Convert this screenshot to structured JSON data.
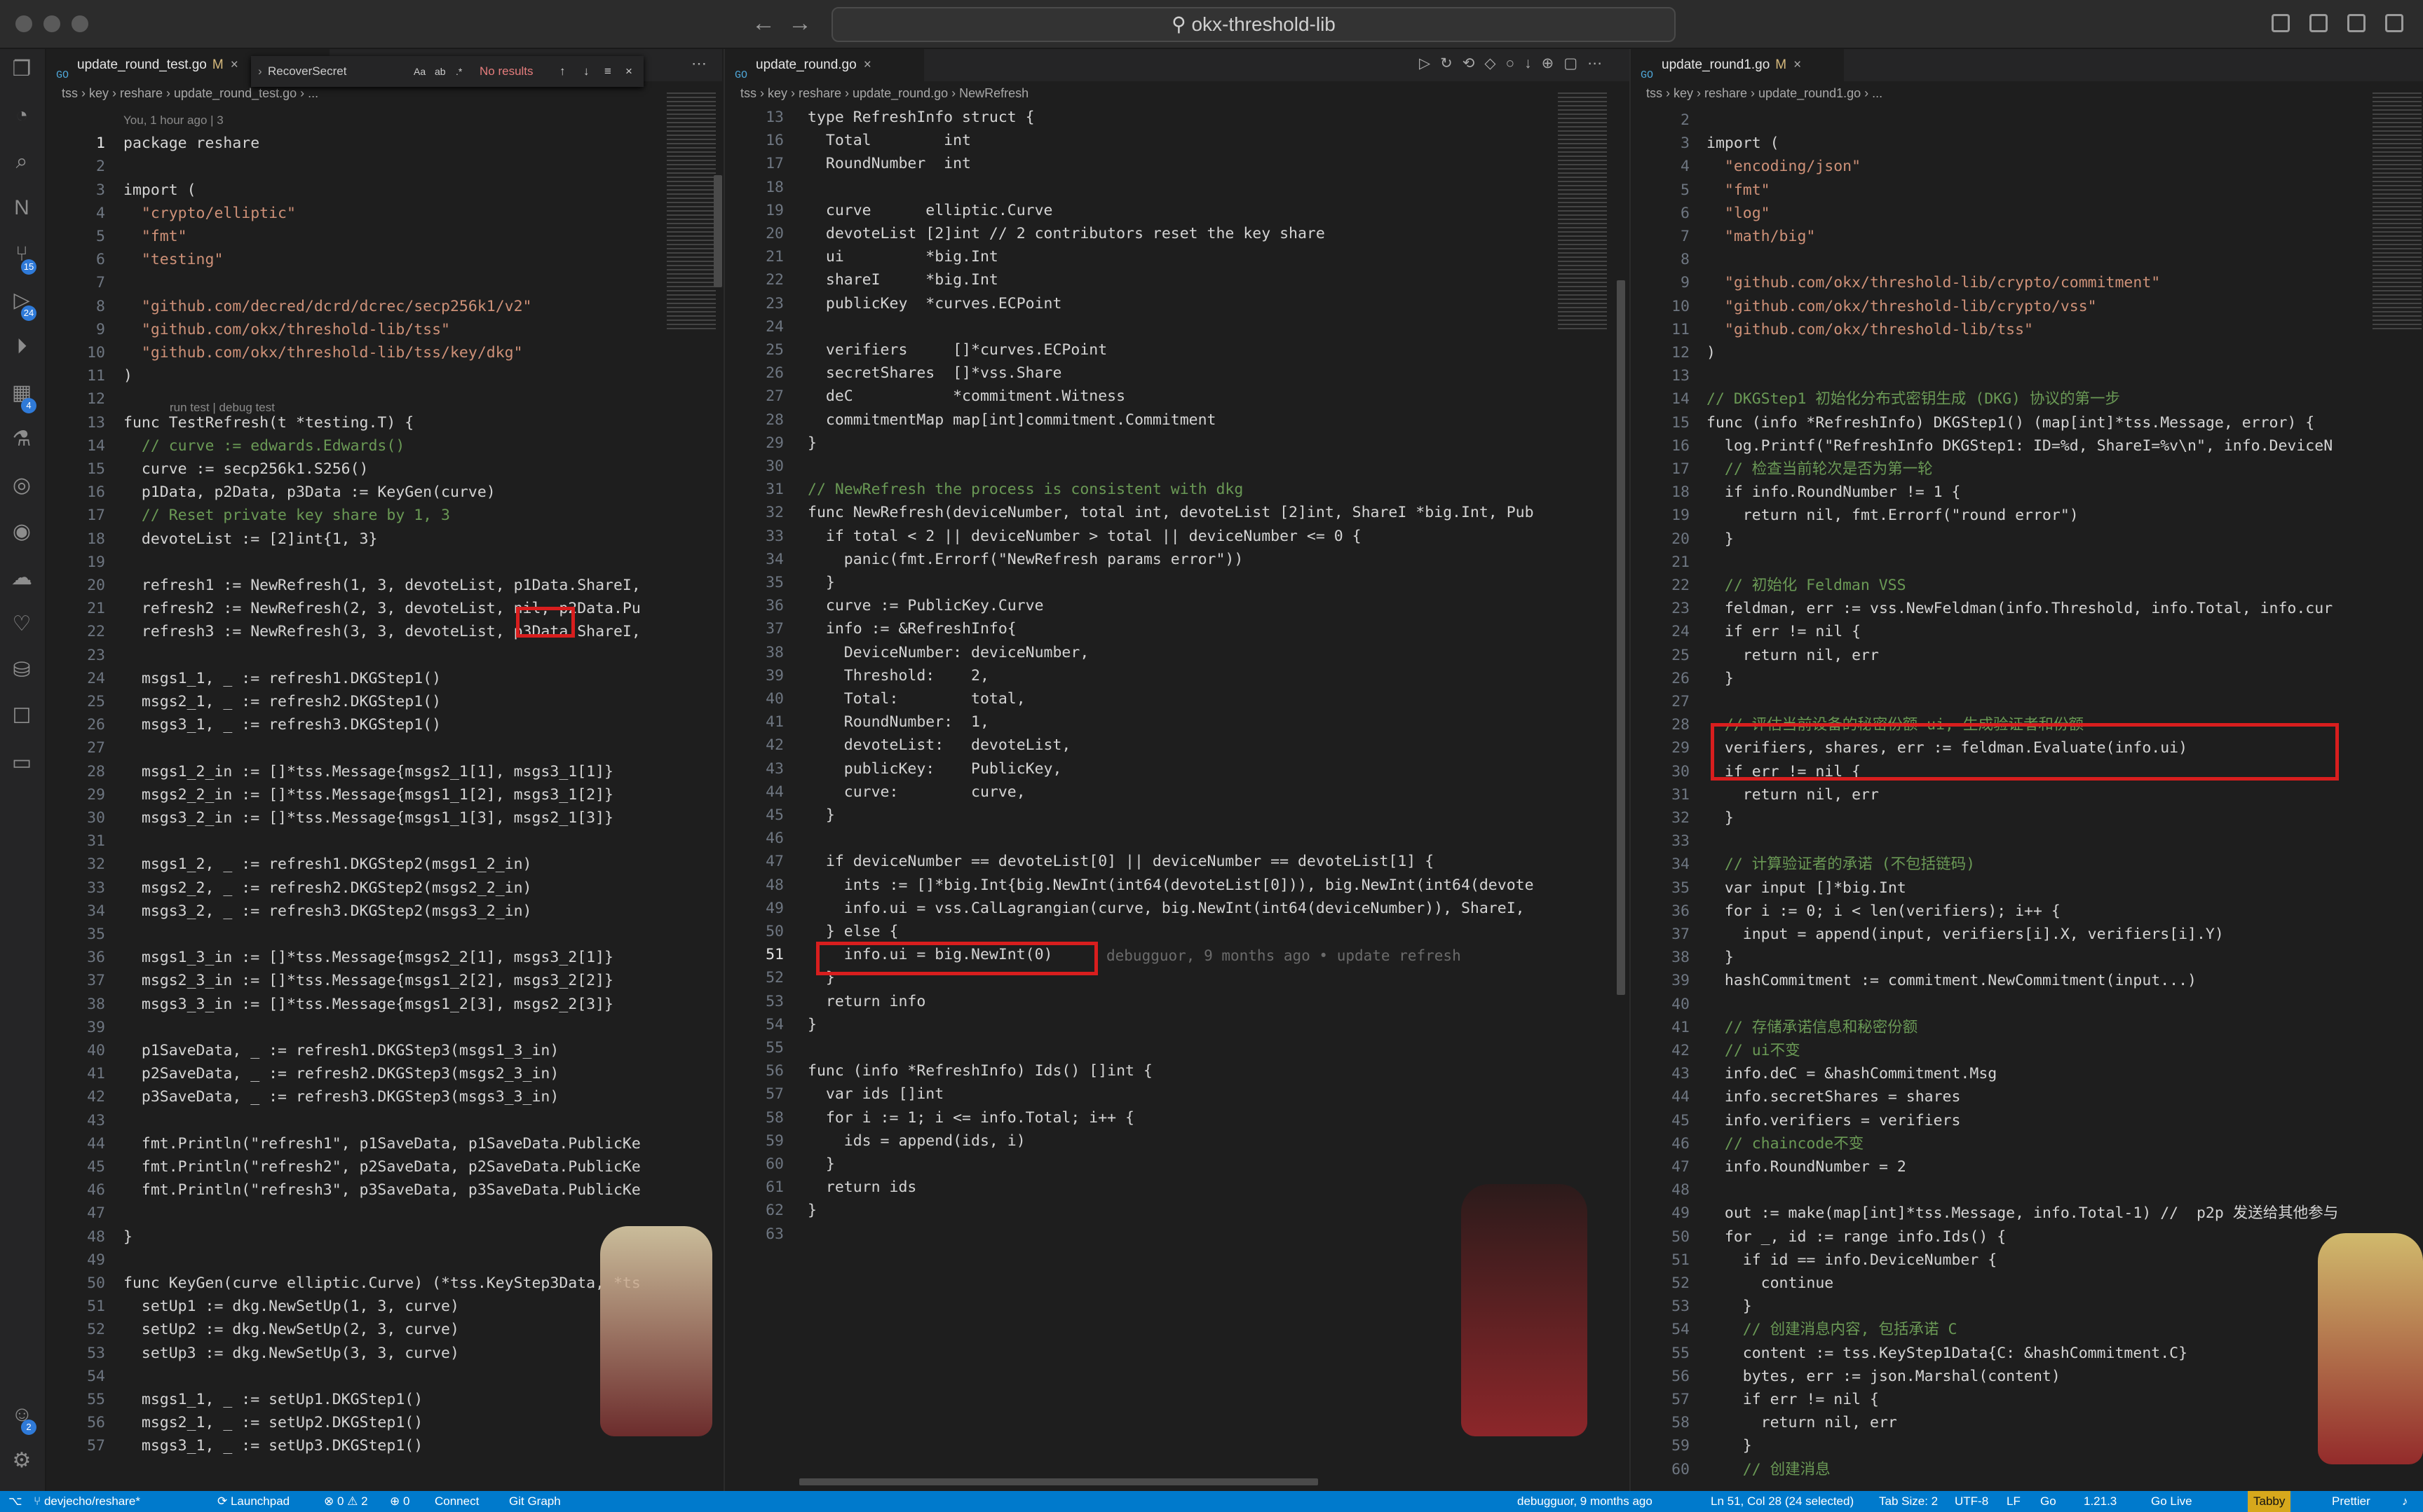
{
  "titlebar": {
    "search": "okx-threshold-lib",
    "back": "←",
    "forward": "→"
  },
  "activity_bar": {
    "badges": {
      "scm": "15",
      "extensions": "24",
      "remote": "4",
      "accounts": "2"
    }
  },
  "find_widget": {
    "value": "RecoverSecret",
    "case": "Aa",
    "word": "ab",
    "regex": ".*",
    "result": "No results"
  },
  "panes": [
    {
      "tab": {
        "name": "update_round_test.go",
        "modified": "M"
      },
      "breadcrumb": "tss › key › reshare › update_round_test.go › ...",
      "lines": [
        {
          "n": "",
          "c": "You, 1 hour ago | 3"
        },
        {
          "n": "1",
          "c": "package reshare"
        },
        {
          "n": "2",
          "c": ""
        },
        {
          "n": "3",
          "c": "import ("
        },
        {
          "n": "4",
          "c": "  \"crypto/elliptic\""
        },
        {
          "n": "5",
          "c": "  \"fmt\""
        },
        {
          "n": "6",
          "c": "  \"testing\""
        },
        {
          "n": "7",
          "c": ""
        },
        {
          "n": "8",
          "c": "  \"github.com/decred/dcrd/dcrec/secp256k1/v2\""
        },
        {
          "n": "9",
          "c": "  \"github.com/okx/threshold-lib/tss\""
        },
        {
          "n": "10",
          "c": "  \"github.com/okx/threshold-lib/tss/key/dkg\""
        },
        {
          "n": "11",
          "c": ")"
        },
        {
          "n": "12",
          "c": ""
        },
        {
          "n": "13",
          "c": "func TestRefresh(t *testing.T) {"
        },
        {
          "n": "14",
          "c": "  // curve := edwards.Edwards()"
        },
        {
          "n": "15",
          "c": "  curve := secp256k1.S256()"
        },
        {
          "n": "16",
          "c": "  p1Data, p2Data, p3Data := KeyGen(curve)"
        },
        {
          "n": "17",
          "c": "  // Reset private key share by 1, 3"
        },
        {
          "n": "18",
          "c": "  devoteList := [2]int{1, 3}"
        },
        {
          "n": "19",
          "c": ""
        },
        {
          "n": "20",
          "c": "  refresh1 := NewRefresh(1, 3, devoteList, p1Data.ShareI,"
        },
        {
          "n": "21",
          "c": "  refresh2 := NewRefresh(2, 3, devoteList, nil, p2Data.Pu"
        },
        {
          "n": "22",
          "c": "  refresh3 := NewRefresh(3, 3, devoteList, p3Data.ShareI,"
        },
        {
          "n": "23",
          "c": ""
        },
        {
          "n": "24",
          "c": "  msgs1_1, _ := refresh1.DKGStep1()"
        },
        {
          "n": "25",
          "c": "  msgs2_1, _ := refresh2.DKGStep1()"
        },
        {
          "n": "26",
          "c": "  msgs3_1, _ := refresh3.DKGStep1()"
        },
        {
          "n": "27",
          "c": ""
        },
        {
          "n": "28",
          "c": "  msgs1_2_in := []*tss.Message{msgs2_1[1], msgs3_1[1]}"
        },
        {
          "n": "29",
          "c": "  msgs2_2_in := []*tss.Message{msgs1_1[2], msgs3_1[2]}"
        },
        {
          "n": "30",
          "c": "  msgs3_2_in := []*tss.Message{msgs1_1[3], msgs2_1[3]}"
        },
        {
          "n": "31",
          "c": ""
        },
        {
          "n": "32",
          "c": "  msgs1_2, _ := refresh1.DKGStep2(msgs1_2_in)"
        },
        {
          "n": "33",
          "c": "  msgs2_2, _ := refresh2.DKGStep2(msgs2_2_in)"
        },
        {
          "n": "34",
          "c": "  msgs3_2, _ := refresh3.DKGStep2(msgs3_2_in)"
        },
        {
          "n": "35",
          "c": ""
        },
        {
          "n": "36",
          "c": "  msgs1_3_in := []*tss.Message{msgs2_2[1], msgs3_2[1]}"
        },
        {
          "n": "37",
          "c": "  msgs2_3_in := []*tss.Message{msgs1_2[2], msgs3_2[2]}"
        },
        {
          "n": "38",
          "c": "  msgs3_3_in := []*tss.Message{msgs1_2[3], msgs2_2[3]}"
        },
        {
          "n": "39",
          "c": ""
        },
        {
          "n": "40",
          "c": "  p1SaveData, _ := refresh1.DKGStep3(msgs1_3_in)"
        },
        {
          "n": "41",
          "c": "  p2SaveData, _ := refresh2.DKGStep3(msgs2_3_in)"
        },
        {
          "n": "42",
          "c": "  p3SaveData, _ := refresh3.DKGStep3(msgs3_3_in)"
        },
        {
          "n": "43",
          "c": ""
        },
        {
          "n": "44",
          "c": "  fmt.Println(\"refresh1\", p1SaveData, p1SaveData.PublicKe"
        },
        {
          "n": "45",
          "c": "  fmt.Println(\"refresh2\", p2SaveData, p2SaveData.PublicKe"
        },
        {
          "n": "46",
          "c": "  fmt.Println(\"refresh3\", p3SaveData, p3SaveData.PublicKe"
        },
        {
          "n": "47",
          "c": ""
        },
        {
          "n": "48",
          "c": "}"
        },
        {
          "n": "49",
          "c": ""
        },
        {
          "n": "50",
          "c": "func KeyGen(curve elliptic.Curve) (*tss.KeyStep3Data, *ts"
        },
        {
          "n": "51",
          "c": "  setUp1 := dkg.NewSetUp(1, 3, curve)"
        },
        {
          "n": "52",
          "c": "  setUp2 := dkg.NewSetUp(2, 3, curve)"
        },
        {
          "n": "53",
          "c": "  setUp3 := dkg.NewSetUp(3, 3, curve)"
        },
        {
          "n": "54",
          "c": ""
        },
        {
          "n": "55",
          "c": "  msgs1_1, _ := setUp1.DKGStep1()"
        },
        {
          "n": "56",
          "c": "  msgs2_1, _ := setUp2.DKGStep1()"
        },
        {
          "n": "57",
          "c": "  msgs3_1, _ := setUp3.DKGStep1()"
        }
      ],
      "codelens": "run test | debug test"
    },
    {
      "tab": {
        "name": "update_round.go",
        "modified": ""
      },
      "breadcrumb": "tss › key › reshare › update_round.go › NewRefresh",
      "lines": [
        {
          "n": "13",
          "c": "type RefreshInfo struct {"
        },
        {
          "n": "16",
          "c": "  Total        int"
        },
        {
          "n": "17",
          "c": "  RoundNumber  int"
        },
        {
          "n": "18",
          "c": ""
        },
        {
          "n": "19",
          "c": "  curve      elliptic.Curve"
        },
        {
          "n": "20",
          "c": "  devoteList [2]int // 2 contributors reset the key share"
        },
        {
          "n": "21",
          "c": "  ui         *big.Int"
        },
        {
          "n": "22",
          "c": "  shareI     *big.Int"
        },
        {
          "n": "23",
          "c": "  publicKey  *curves.ECPoint"
        },
        {
          "n": "24",
          "c": ""
        },
        {
          "n": "25",
          "c": "  verifiers     []*curves.ECPoint"
        },
        {
          "n": "26",
          "c": "  secretShares  []*vss.Share"
        },
        {
          "n": "27",
          "c": "  deC           *commitment.Witness"
        },
        {
          "n": "28",
          "c": "  commitmentMap map[int]commitment.Commitment"
        },
        {
          "n": "29",
          "c": "}"
        },
        {
          "n": "30",
          "c": ""
        },
        {
          "n": "31",
          "c": "// NewRefresh the process is consistent with dkg"
        },
        {
          "n": "32",
          "c": "func NewRefresh(deviceNumber, total int, devoteList [2]int, ShareI *big.Int, Pub"
        },
        {
          "n": "33",
          "c": "  if total < 2 || deviceNumber > total || deviceNumber <= 0 {"
        },
        {
          "n": "34",
          "c": "    panic(fmt.Errorf(\"NewRefresh params error\"))"
        },
        {
          "n": "35",
          "c": "  }"
        },
        {
          "n": "36",
          "c": "  curve := PublicKey.Curve"
        },
        {
          "n": "37",
          "c": "  info := &RefreshInfo{"
        },
        {
          "n": "38",
          "c": "    DeviceNumber: deviceNumber,"
        },
        {
          "n": "39",
          "c": "    Threshold:    2,"
        },
        {
          "n": "40",
          "c": "    Total:        total,"
        },
        {
          "n": "41",
          "c": "    RoundNumber:  1,"
        },
        {
          "n": "42",
          "c": "    devoteList:   devoteList,"
        },
        {
          "n": "43",
          "c": "    publicKey:    PublicKey,"
        },
        {
          "n": "44",
          "c": "    curve:        curve,"
        },
        {
          "n": "45",
          "c": "  }"
        },
        {
          "n": "46",
          "c": ""
        },
        {
          "n": "47",
          "c": "  if deviceNumber == devoteList[0] || deviceNumber == devoteList[1] {"
        },
        {
          "n": "48",
          "c": "    ints := []*big.Int{big.NewInt(int64(devoteList[0])), big.NewInt(int64(devote"
        },
        {
          "n": "49",
          "c": "    info.ui = vss.CalLagrangian(curve, big.NewInt(int64(deviceNumber)), ShareI,"
        },
        {
          "n": "50",
          "c": "  } else {"
        },
        {
          "n": "51",
          "c": "    info.ui = big.NewInt(0)"
        },
        {
          "n": "52",
          "c": "  }"
        },
        {
          "n": "53",
          "c": "  return info"
        },
        {
          "n": "54",
          "c": "}"
        },
        {
          "n": "55",
          "c": ""
        },
        {
          "n": "56",
          "c": "func (info *RefreshInfo) Ids() []int {"
        },
        {
          "n": "57",
          "c": "  var ids []int"
        },
        {
          "n": "58",
          "c": "  for i := 1; i <= info.Total; i++ {"
        },
        {
          "n": "59",
          "c": "    ids = append(ids, i)"
        },
        {
          "n": "60",
          "c": "  }"
        },
        {
          "n": "61",
          "c": "  return ids"
        },
        {
          "n": "62",
          "c": "}"
        },
        {
          "n": "63",
          "c": ""
        }
      ],
      "blame": "debugguor, 9 months ago • update refresh"
    },
    {
      "tab": {
        "name": "update_round1.go",
        "modified": "M"
      },
      "breadcrumb": "tss › key › reshare › update_round1.go › ...",
      "lines": [
        {
          "n": "2",
          "c": ""
        },
        {
          "n": "3",
          "c": "import ("
        },
        {
          "n": "4",
          "c": "  \"encoding/json\""
        },
        {
          "n": "5",
          "c": "  \"fmt\""
        },
        {
          "n": "6",
          "c": "  \"log\""
        },
        {
          "n": "7",
          "c": "  \"math/big\""
        },
        {
          "n": "8",
          "c": ""
        },
        {
          "n": "9",
          "c": "  \"github.com/okx/threshold-lib/crypto/commitment\""
        },
        {
          "n": "10",
          "c": "  \"github.com/okx/threshold-lib/crypto/vss\""
        },
        {
          "n": "11",
          "c": "  \"github.com/okx/threshold-lib/tss\""
        },
        {
          "n": "12",
          "c": ")"
        },
        {
          "n": "13",
          "c": ""
        },
        {
          "n": "14",
          "c": "// DKGStep1 初始化分布式密钥生成 (DKG) 协议的第一步"
        },
        {
          "n": "15",
          "c": "func (info *RefreshInfo) DKGStep1() (map[int]*tss.Message, error) {"
        },
        {
          "n": "16",
          "c": "  log.Printf(\"RefreshInfo DKGStep1: ID=%d, ShareI=%v\\n\", info.DeviceN"
        },
        {
          "n": "17",
          "c": "  // 检查当前轮次是否为第一轮"
        },
        {
          "n": "18",
          "c": "  if info.RoundNumber != 1 {"
        },
        {
          "n": "19",
          "c": "    return nil, fmt.Errorf(\"round error\")"
        },
        {
          "n": "20",
          "c": "  }"
        },
        {
          "n": "21",
          "c": ""
        },
        {
          "n": "22",
          "c": "  // 初始化 Feldman VSS"
        },
        {
          "n": "23",
          "c": "  feldman, err := vss.NewFeldman(info.Threshold, info.Total, info.cur"
        },
        {
          "n": "24",
          "c": "  if err != nil {"
        },
        {
          "n": "25",
          "c": "    return nil, err"
        },
        {
          "n": "26",
          "c": "  }"
        },
        {
          "n": "27",
          "c": ""
        },
        {
          "n": "28",
          "c": "  // 评估当前设备的秘密份额 ui, 生成验证者和份额"
        },
        {
          "n": "29",
          "c": "  verifiers, shares, err := feldman.Evaluate(info.ui)"
        },
        {
          "n": "30",
          "c": "  if err != nil {"
        },
        {
          "n": "31",
          "c": "    return nil, err"
        },
        {
          "n": "32",
          "c": "  }"
        },
        {
          "n": "33",
          "c": ""
        },
        {
          "n": "34",
          "c": "  // 计算验证者的承诺 (不包括链码)"
        },
        {
          "n": "35",
          "c": "  var input []*big.Int"
        },
        {
          "n": "36",
          "c": "  for i := 0; i < len(verifiers); i++ {"
        },
        {
          "n": "37",
          "c": "    input = append(input, verifiers[i].X, verifiers[i].Y)"
        },
        {
          "n": "38",
          "c": "  }"
        },
        {
          "n": "39",
          "c": "  hashCommitment := commitment.NewCommitment(input...)"
        },
        {
          "n": "40",
          "c": ""
        },
        {
          "n": "41",
          "c": "  // 存储承诺信息和秘密份额"
        },
        {
          "n": "42",
          "c": "  // ui不变"
        },
        {
          "n": "43",
          "c": "  info.deC = &hashCommitment.Msg"
        },
        {
          "n": "44",
          "c": "  info.secretShares = shares"
        },
        {
          "n": "45",
          "c": "  info.verifiers = verifiers"
        },
        {
          "n": "46",
          "c": "  // chaincode不变"
        },
        {
          "n": "47",
          "c": "  info.RoundNumber = 2"
        },
        {
          "n": "48",
          "c": ""
        },
        {
          "n": "49",
          "c": "  out := make(map[int]*tss.Message, info.Total-1) //  p2p 发送给其他参与"
        },
        {
          "n": "50",
          "c": "  for _, id := range info.Ids() {"
        },
        {
          "n": "51",
          "c": "    if id == info.DeviceNumber {"
        },
        {
          "n": "52",
          "c": "      continue"
        },
        {
          "n": "53",
          "c": "    }"
        },
        {
          "n": "54",
          "c": "    // 创建消息内容, 包括承诺 C"
        },
        {
          "n": "55",
          "c": "    content := tss.KeyStep1Data{C: &hashCommitment.C}"
        },
        {
          "n": "56",
          "c": "    bytes, err := json.Marshal(content)"
        },
        {
          "n": "57",
          "c": "    if err != nil {"
        },
        {
          "n": "58",
          "c": "      return nil, err"
        },
        {
          "n": "59",
          "c": "    }"
        },
        {
          "n": "60",
          "c": "    // 创建消息"
        }
      ]
    }
  ],
  "statusbar": {
    "branch": "devjecho/reshare*",
    "launchpad": "Launchpad",
    "problems": "⊗ 0 ⚠ 2",
    "ports": "⊕ 0",
    "connect": "Connect",
    "gitgraph": "Git Graph",
    "blame": "debugguor, 9 months ago",
    "position": "Ln 51, Col 28 (24 selected)",
    "tabsize": "Tab Size: 2",
    "encoding": "UTF-8",
    "eol": "LF",
    "lang": "Go",
    "version": "1.21.3",
    "golive": "Go Live",
    "tabby": "Tabby",
    "prettier": "Prettier"
  },
  "colors": {
    "accent": "#007acc",
    "highlight_box": "#d81e1e",
    "keyword": "#569cd6",
    "string": "#ce9178",
    "comment": "#6a9955"
  }
}
